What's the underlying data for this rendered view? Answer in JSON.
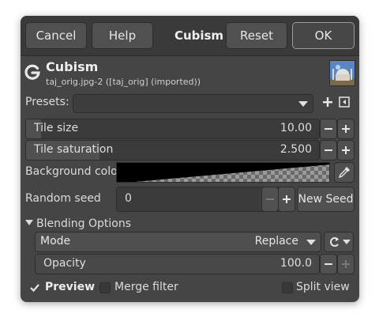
{
  "header": {
    "cancel_label": "Cancel",
    "help_label": "Help",
    "title": "Cubism",
    "reset_label": "Reset",
    "ok_label": "OK"
  },
  "filter": {
    "name": "Cubism",
    "subtitle": "taj_orig.jpg-2 ([taj_orig] (imported))"
  },
  "presets": {
    "label": "Presets:",
    "value": ""
  },
  "tile_size": {
    "label": "Tile size",
    "value": "10.00",
    "fill_fraction": 0.05
  },
  "tile_saturation": {
    "label": "Tile saturation",
    "value": "2.500",
    "fill_fraction": 0.25
  },
  "background_color": {
    "label": "Background color"
  },
  "random_seed": {
    "label": "Random seed",
    "value": "0",
    "new_seed_label": "New Seed"
  },
  "blending": {
    "expander_label": "Blending Options",
    "mode_label": "Mode",
    "mode_value": "Replace",
    "opacity_label": "Opacity",
    "opacity_value": "100.0"
  },
  "footer": {
    "preview_label": "Preview",
    "preview_checked": true,
    "merge_filter_label": "Merge filter",
    "merge_filter_checked": false,
    "split_view_label": "Split view",
    "split_view_checked": false
  },
  "colors": {
    "dialog_bg": "#454545",
    "header_bg": "#3a3a3a",
    "field_bg": "#3b3b3b",
    "button_bg": "#505050",
    "text": "#dcdcdc"
  }
}
